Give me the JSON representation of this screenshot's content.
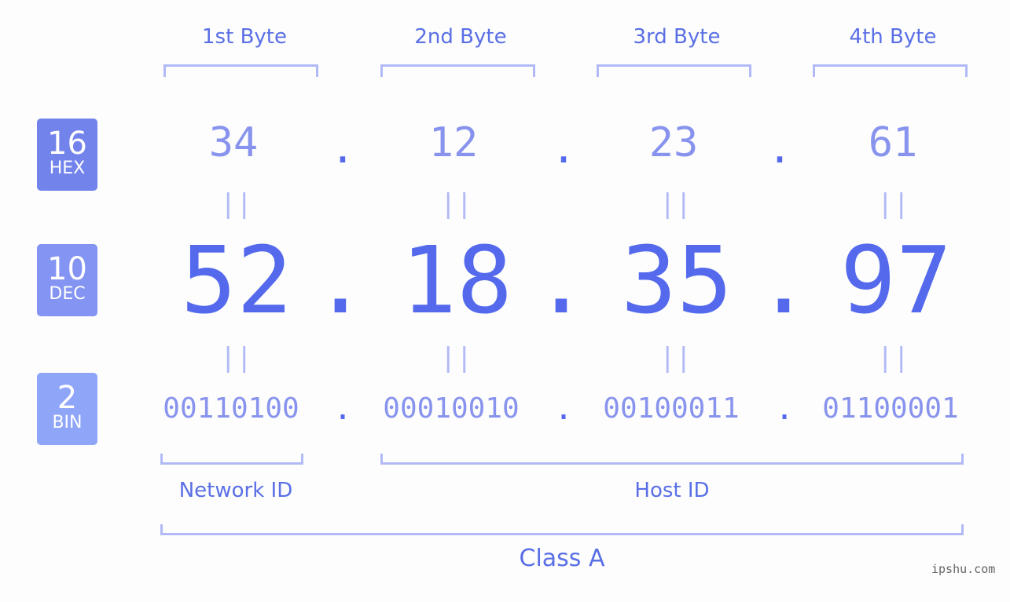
{
  "badges": [
    {
      "num": "16",
      "label": "HEX",
      "color": "#7383ec"
    },
    {
      "num": "10",
      "label": "DEC",
      "color": "#8494f2"
    },
    {
      "num": "2",
      "label": "BIN",
      "color": "#8fa6f8"
    }
  ],
  "bytes": [
    {
      "label": "1st Byte",
      "hex": "34",
      "dec": "52",
      "bin": "00110100"
    },
    {
      "label": "2nd Byte",
      "hex": "12",
      "dec": "18",
      "bin": "00010010"
    },
    {
      "label": "3rd Byte",
      "hex": "23",
      "dec": "35",
      "bin": "00100011"
    },
    {
      "label": "4th Byte",
      "hex": "61",
      "dec": "97",
      "bin": "01100001"
    }
  ],
  "separator": ".",
  "equals": "||",
  "network_id_label": "Network ID",
  "host_id_label": "Host ID",
  "class_label": "Class A",
  "watermark": "ipshu.com"
}
